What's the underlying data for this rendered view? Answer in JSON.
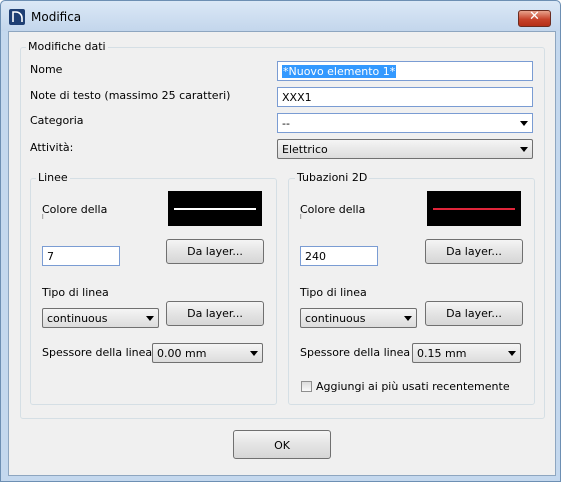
{
  "window": {
    "title": "Modifica",
    "close_glyph": "✕"
  },
  "data_group": {
    "title": "Modifiche dati",
    "name_label": "Nome",
    "name_value": "*Nuovo elemento 1*",
    "note_label": "Note di testo (massimo 25 caratteri)",
    "note_value": "XXX1",
    "category_label": "Categoria",
    "category_value": "--",
    "activity_label": "Attività:",
    "activity_value": "Elettrico"
  },
  "lines_group": {
    "title": "Linee",
    "color_label": "Colore della",
    "color_sublabel": "l",
    "color_swatch": "#ffffff",
    "color_value": "7",
    "color_layer_button": "Da layer...",
    "linetype_label": "Tipo di linea",
    "linetype_value": "continuous",
    "linetype_layer_button": "Da layer...",
    "thickness_label": "Spessore della linea",
    "thickness_value": "0.00 mm"
  },
  "pipes_group": {
    "title": "Tubazioni 2D",
    "color_label": "Colore della",
    "color_sublabel": "l",
    "color_swatch": "#e0253a",
    "color_value": "240",
    "color_layer_button": "Da layer...",
    "linetype_label": "Tipo di linea",
    "linetype_value": "continuous",
    "linetype_layer_button": "Da layer...",
    "thickness_label": "Spessore della linea",
    "thickness_value": "0.15 mm",
    "recent_checkbox_label": "Aggiungi ai più usati recentemente",
    "recent_checked": false
  },
  "footer": {
    "ok_label": "OK"
  },
  "colors": {
    "accent": "#3399ff",
    "frame": "#c4d8ee"
  }
}
